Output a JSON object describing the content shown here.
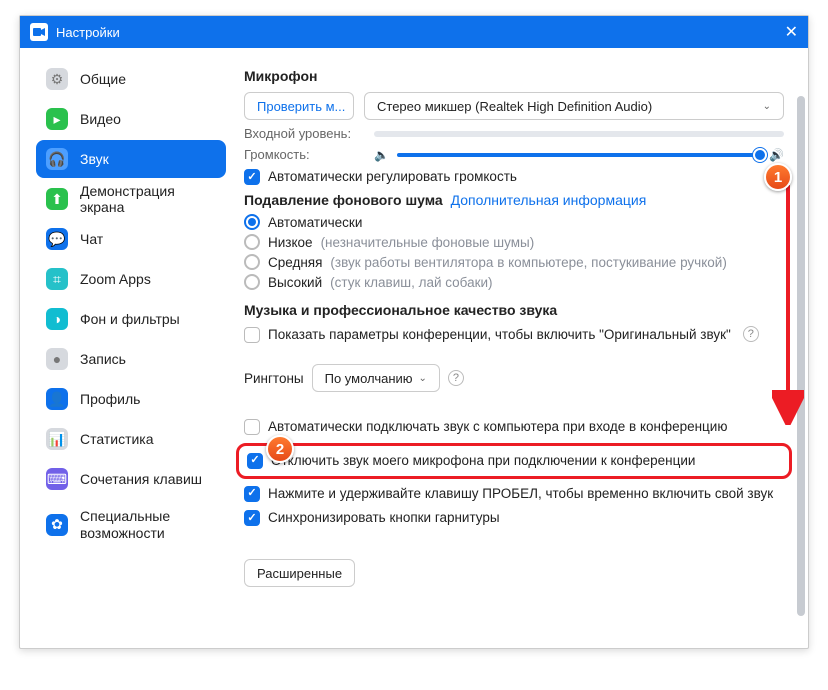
{
  "window": {
    "title": "Настройки"
  },
  "sidebar": {
    "items": [
      {
        "label": "Общие",
        "icon": "⚙",
        "bg": "#d6d9de"
      },
      {
        "label": "Видео",
        "icon": "■",
        "bg": "#2ac14d"
      },
      {
        "label": "Звук",
        "icon": "🎧",
        "bg": "#0e71eb",
        "active": true
      },
      {
        "label": "Демонстрация экрана",
        "icon": "⬆",
        "bg": "#2ac14d"
      },
      {
        "label": "Чат",
        "icon": "💬",
        "bg": "#0e71eb"
      },
      {
        "label": "Zoom Apps",
        "icon": "⌗",
        "bg": "#25c1c9"
      },
      {
        "label": "Фон и фильтры",
        "icon": "◑",
        "bg": "#11bdd1"
      },
      {
        "label": "Запись",
        "icon": "●",
        "bg": "#d6d9de"
      },
      {
        "label": "Профиль",
        "icon": "👤",
        "bg": "#0e71eb"
      },
      {
        "label": "Статистика",
        "icon": "📊",
        "bg": "#d6d9de"
      },
      {
        "label": "Сочетания клавиш",
        "icon": "⌨",
        "bg": "#7160e8"
      },
      {
        "label": "Специальные возможности",
        "icon": "✿",
        "bg": "#0e71eb"
      }
    ]
  },
  "mic": {
    "heading": "Микрофон",
    "test_btn": "Проверить м...",
    "device": "Стерео микшер (Realtek High Definition Audio)",
    "input_level_label": "Входной уровень:",
    "volume_label": "Громкость:",
    "auto_adjust": "Автоматически регулировать громкость"
  },
  "noise": {
    "heading": "Подавление фонового шума",
    "link": "Дополнительная информация",
    "opts": [
      {
        "label": "Автоматически",
        "hint": "",
        "sel": true
      },
      {
        "label": "Низкое",
        "hint": "(незначительные фоновые шумы)"
      },
      {
        "label": "Средняя",
        "hint": "(звук работы вентилятора в компьютере, постукивание ручкой)"
      },
      {
        "label": "Высокий",
        "hint": "(стук клавиш, лай собаки)"
      }
    ]
  },
  "music": {
    "heading": "Музыка и профессиональное качество звука",
    "orig_sound": "Показать параметры конференции, чтобы включить \"Оригинальный звук\""
  },
  "ringtones": {
    "label": "Рингтоны",
    "value": "По умолчанию"
  },
  "opts": {
    "auto_connect": "Автоматически подключать звук с компьютера при входе в конференцию",
    "mute_on_join": "Отключить звук моего микрофона при подключении к конференции",
    "spacebar_unmute": "Нажмите и удерживайте клавишу ПРОБЕЛ, чтобы временно включить свой звук",
    "sync_headset": "Синхронизировать кнопки гарнитуры"
  },
  "advanced_btn": "Расширенные",
  "anno": {
    "one": "1",
    "two": "2"
  }
}
